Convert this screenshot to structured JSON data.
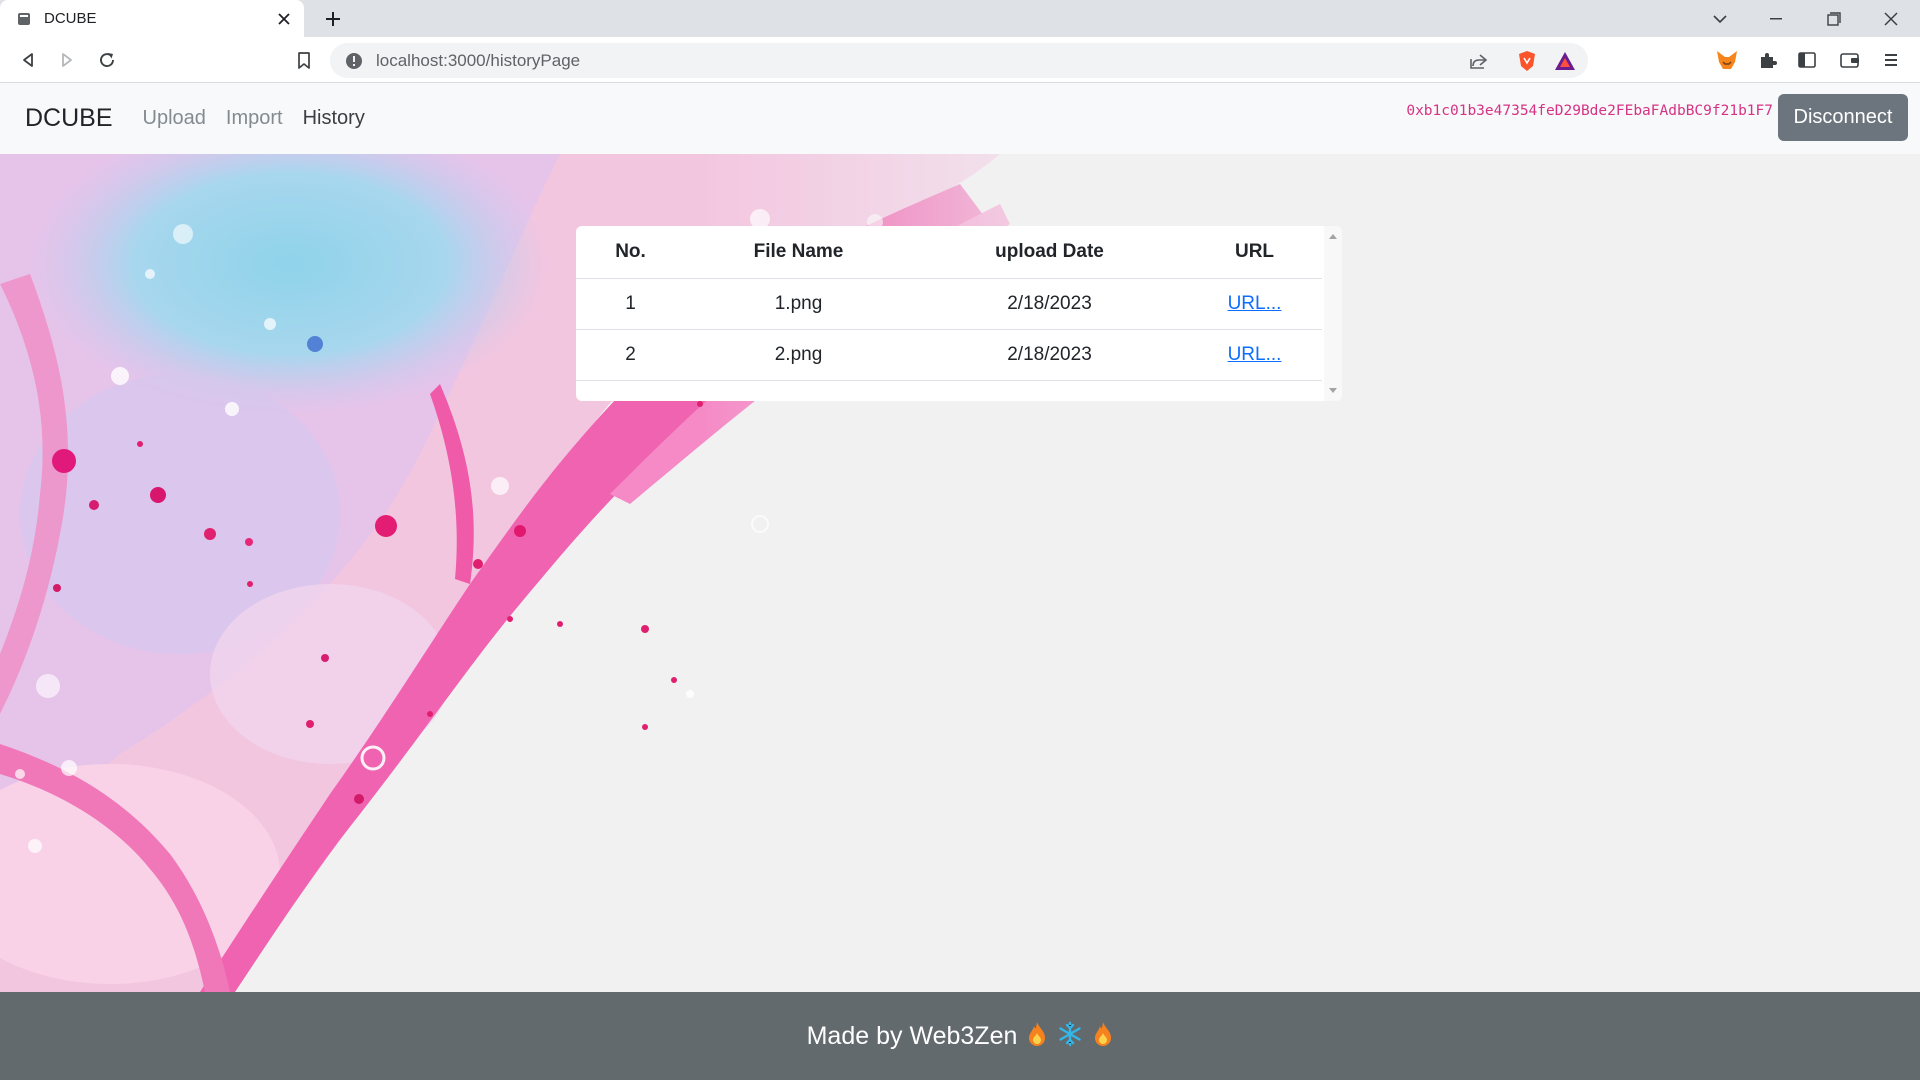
{
  "browser": {
    "tab_title": "DCUBE",
    "url": "localhost:3000/historyPage"
  },
  "navbar": {
    "brand": "DCUBE",
    "links": [
      "Upload",
      "Import",
      "History"
    ],
    "active_link": "History",
    "wallet_address": "0xb1c01b3e47354feD29Bde2FEbaFAdbBC9f21b1F7",
    "disconnect_label": "Disconnect"
  },
  "history_table": {
    "headers": [
      "No.",
      "File Name",
      "upload Date",
      "URL"
    ],
    "rows": [
      {
        "no": "1",
        "file_name": "1.png",
        "upload_date": "2/18/2023",
        "url_label": "URL..."
      },
      {
        "no": "2",
        "file_name": "2.png",
        "upload_date": "2/18/2023",
        "url_label": "URL..."
      }
    ]
  },
  "footer": {
    "text": "Made by Web3Zen",
    "emojis": [
      "fire-icon",
      "snowflake-icon",
      "fire-icon"
    ]
  },
  "colors": {
    "navbar_bg": "#f8f9fa",
    "address": "#d63384",
    "disconnect_bg": "#6c757d",
    "link": "#0d6efd",
    "footer_bg": "#636a6e"
  }
}
